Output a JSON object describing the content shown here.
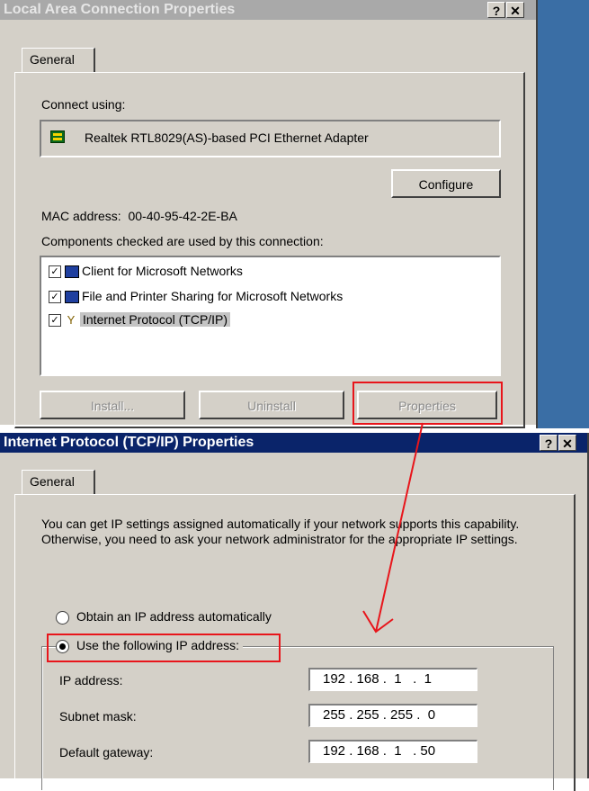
{
  "lan_dialog": {
    "title": "Local Area Connection Properties",
    "help_btn": "?",
    "close_btn": "✕",
    "tab": "General",
    "connect_using_label": "Connect using:",
    "adapter": "Realtek RTL8029(AS)-based PCI Ethernet Adapter",
    "configure_btn": "Configure",
    "mac_label": "MAC address:  00-40-95-42-2E-BA",
    "components_label": "Components checked are used by this connection:",
    "components": [
      {
        "label": "Client for Microsoft Networks",
        "checked": true
      },
      {
        "label": "File and Printer Sharing for Microsoft Networks",
        "checked": true
      },
      {
        "label": "Internet Protocol (TCP/IP)",
        "checked": true,
        "selected": true
      }
    ],
    "install_btn": "Install...",
    "uninstall_btn": "Uninstall",
    "properties_btn": "Properties"
  },
  "tcp_dialog": {
    "title": "Internet Protocol (TCP/IP) Properties",
    "help_btn": "?",
    "close_btn": "✕",
    "tab": "General",
    "description": "You can get IP settings assigned automatically if your network supports this capability. Otherwise, you need to ask your network administrator for the appropriate IP settings.",
    "radio_auto": "Obtain an IP address automatically",
    "radio_manual": "Use the following IP address:",
    "ip_label": "IP address:",
    "ip_value": "192 . 168 .  1   .  1",
    "subnet_label": "Subnet mask:",
    "subnet_value": "255 . 255 . 255 .  0",
    "gateway_label": "Default gateway:",
    "gateway_value": "192 . 168 .  1   . 50"
  },
  "colors": {
    "lan_title_bg": "#a9a9a9",
    "tcp_title_bg": "#0a246a",
    "annotation": "#e8151b",
    "desktop": "#3a6ea5"
  }
}
